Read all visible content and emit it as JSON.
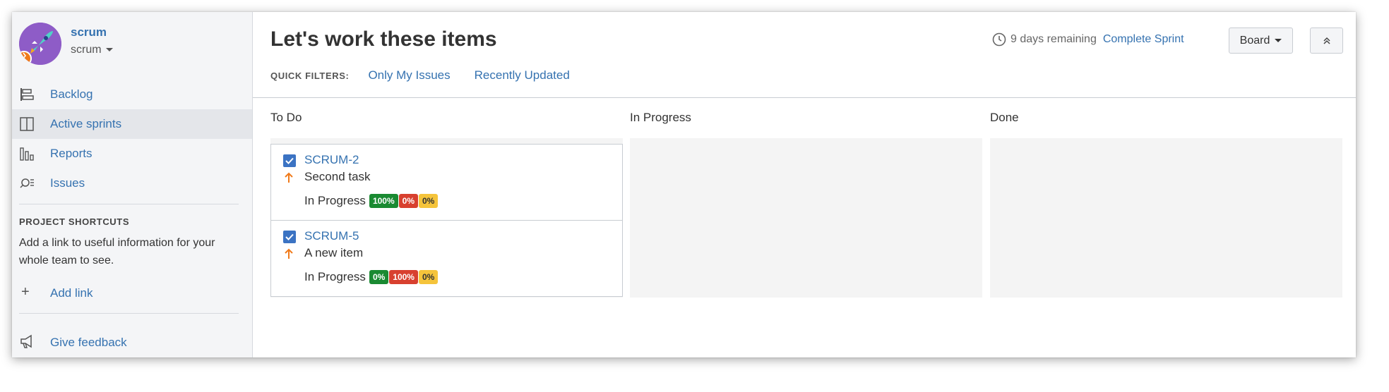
{
  "project": {
    "name": "scrum",
    "type": "scrum"
  },
  "sidebar": {
    "items": [
      {
        "label": "Backlog",
        "icon": "backlog-icon",
        "active": false
      },
      {
        "label": "Active sprints",
        "icon": "board-icon",
        "active": true
      },
      {
        "label": "Reports",
        "icon": "reports-icon",
        "active": false
      },
      {
        "label": "Issues",
        "icon": "issues-search-icon",
        "active": false
      }
    ],
    "shortcuts_title": "PROJECT SHORTCUTS",
    "shortcuts_desc": "Add a link to useful information for your whole team to see.",
    "add_link": "Add link",
    "feedback": "Give feedback"
  },
  "header": {
    "title": "Let's work these items",
    "remaining": "9 days remaining",
    "complete_sprint": "Complete Sprint",
    "board_label": "Board",
    "quick_filters_label": "QUICK FILTERS:",
    "quick_filters": [
      "Only My Issues",
      "Recently Updated"
    ]
  },
  "columns": [
    {
      "title": "To Do",
      "cards": [
        {
          "key": "SCRUM-2",
          "summary": "Second task",
          "status": "In Progress",
          "badges": [
            "100%",
            "0%",
            "0%"
          ]
        },
        {
          "key": "SCRUM-5",
          "summary": "A new item",
          "status": "In Progress",
          "badges": [
            "0%",
            "100%",
            "0%"
          ]
        }
      ]
    },
    {
      "title": "In Progress",
      "cards": []
    },
    {
      "title": "Done",
      "cards": []
    }
  ],
  "colors": {
    "link": "#3572b0",
    "badge_green": "#1a8a32",
    "badge_red": "#d8402f",
    "badge_yellow": "#f5c43b",
    "priority": "#f07a1a",
    "checkbox": "#3b73c3"
  }
}
